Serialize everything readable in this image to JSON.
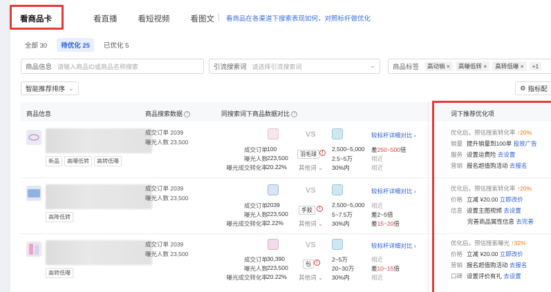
{
  "tabs": [
    {
      "label": "看商品卡"
    },
    {
      "label": "看直播"
    },
    {
      "label": "看短视频"
    },
    {
      "label": "看图文"
    }
  ],
  "tab_note": "看商品在各渠道下搜索表现如何，对照标杆做优化",
  "filters": [
    {
      "label": "全部 30"
    },
    {
      "label": "待优化 25"
    },
    {
      "label": "已优化 5"
    }
  ],
  "fields": {
    "product_label": "商品信息",
    "product_placeholder": "请输入商品ID或商品名称搜索",
    "keyword_label": "引流搜索词",
    "keyword_placeholder": "请选择引流搜索词",
    "tag_label": "商品标签",
    "tag_chips": [
      "高动销",
      "高曝低转",
      "高转低曝"
    ],
    "tag_more": "+1"
  },
  "sort_label": "智能推荐排序",
  "config_label": "指标配",
  "headers": {
    "product": "商品信息",
    "search_data": "商品搜索数据",
    "compare": "同搜索词下商品数据对比",
    "optimize": "词下推荐优化项"
  },
  "rows": [
    {
      "tags": [
        "新品",
        "高曝低转",
        "高转低曝"
      ],
      "orders": "成交订单 2039",
      "exposure": "曝光人数 23,500",
      "labels": [
        "成交订单",
        "曝光人数",
        "曝光成交转化率"
      ],
      "mine": [
        "100",
        "223,500",
        "20.22%"
      ],
      "keyword": "羽毛球",
      "other": "其他词",
      "bench": [
        "2,500~5,000",
        "2.5~5万",
        "30%内"
      ],
      "link": "较标杆详细对比",
      "diff": [
        {
          "pre": "差",
          "val": "250~500",
          "post": "倍"
        },
        {
          "txt": "相近"
        },
        {
          "txt": "相近"
        }
      ],
      "opt_head": "优化后，预估搜索转化率",
      "opt_val": "20%",
      "opts": [
        {
          "k": "销量",
          "t": "提升销量到100单",
          "a": "投放广告"
        },
        {
          "k": "服务",
          "t": "设置运费险",
          "a": "去设置"
        },
        {
          "k": "营销",
          "t": "报名超值购活动",
          "a": "去报名"
        }
      ]
    },
    {
      "tags": [
        "高降低转"
      ],
      "orders": "成交订单 2039",
      "exposure": "曝光人数 23,500",
      "labels": [
        "成交订单",
        "曝光人数",
        "曝光成交转化率"
      ],
      "mine": [
        "2039",
        "223,500",
        "2.22%"
      ],
      "keyword": "手胶",
      "other": "其他词",
      "bench": [
        "2,500~5,000",
        "5~7.5万",
        "30%内"
      ],
      "link": "较标杆详细对比",
      "diff": [
        {
          "txt": "相近"
        },
        {
          "pre": "差",
          "val": "2~5",
          "post": "倍",
          "plain": true
        },
        {
          "pre": "差",
          "val": "15~20",
          "post": "倍"
        }
      ],
      "opt_head": "优化后，预估搜索转化率",
      "opt_val": "20%",
      "opts": [
        {
          "k": "价格",
          "t": "立减 ¥20.00",
          "a": "立即改价"
        },
        {
          "k": "信息",
          "t": "设置主图视频",
          "a": "去设置"
        },
        {
          "k": "",
          "t": "完善商品属性信息",
          "a": "去完善"
        }
      ]
    },
    {
      "tags": [
        "高转低曝"
      ],
      "orders": "成交订单 2039",
      "exposure": "曝光人数 23,500",
      "labels": [
        "成交订单",
        "曝光人数",
        "曝光成交转化率"
      ],
      "mine": [
        "30,390",
        "223,500",
        "20.22%"
      ],
      "keyword": "包",
      "other": "其他词",
      "bench": [
        "2~5万",
        "20~30万",
        "30%内"
      ],
      "link": "较标杆详细对比",
      "diff": [
        {
          "txt": "相近"
        },
        {
          "pre": "差",
          "val": "10~15",
          "post": "倍"
        },
        {
          "txt": "相近"
        }
      ],
      "opt_head": "优化后，预估搜索曝光",
      "opt_val": "32%",
      "opts": [
        {
          "k": "价格",
          "t": "立减 ¥20.00",
          "a": "立即改价"
        },
        {
          "k": "营销",
          "t": "报名超值购活动",
          "a": "去报名"
        },
        {
          "k": "口碑",
          "t": "设置评价有礼",
          "a": "去设置"
        }
      ]
    }
  ],
  "vs": "VS",
  "colors": {
    "accent": "#2f62d6",
    "alert": "#e53935",
    "up": "#f5730e"
  }
}
